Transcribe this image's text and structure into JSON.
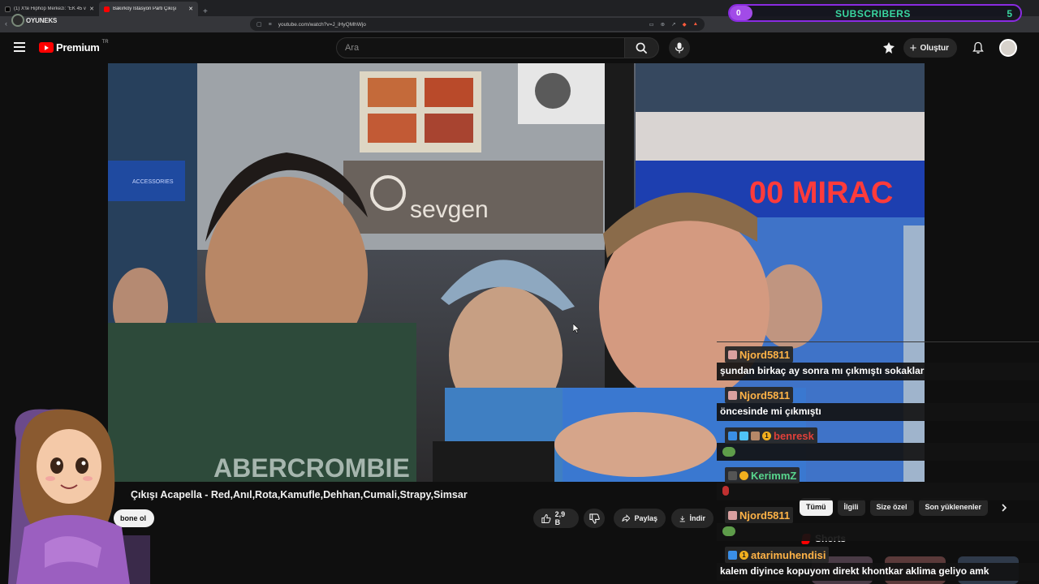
{
  "browser": {
    "tabs": [
      {
        "label": "(1) X'te Hiphop Merkezi: \"EK 45 ve II",
        "active": false
      },
      {
        "label": "Bakırköy İstasyon Parti Çıkışı",
        "active": true
      }
    ],
    "url": "youtube.com/watch?v=J_iHyQMhWjo"
  },
  "overlay": {
    "logo_text": "OYUNEKS",
    "subscribers": {
      "label": "SUBSCRIBERS",
      "current": "0",
      "goal": "5",
      "progress": 0.0
    }
  },
  "youtube": {
    "brand": "Premium",
    "region": "TR",
    "search_placeholder": "Ara",
    "create_label": "Oluştur",
    "video_title": "Çıkışı Acapella - Red,Anıl,Rota,Kamufle,Dehhan,Cumali,Strapy,Simsar",
    "subscribe_label": "bone ol",
    "like_count": "2,9 B",
    "share_label": "Paylaş",
    "download_label": "İndir",
    "chips": [
      {
        "label": "Tümü",
        "selected": true
      },
      {
        "label": "İlgili",
        "selected": false
      },
      {
        "label": "Size özel",
        "selected": false
      },
      {
        "label": "Son yüklenenler",
        "selected": false
      }
    ],
    "shorts_label": "Shorts"
  },
  "video_scene": {
    "shop_sign": "sevgen",
    "led_sign": "00 MIRAC",
    "store_small_sign": "ACCESSORIES",
    "shirt_text": "ABERCROMBIE"
  },
  "chat": [
    {
      "user": "Njord5811",
      "color": "#ffb347",
      "text": "şundan birkaç ay sonra mı çıkmıştı sokaklar"
    },
    {
      "user": "Njord5811",
      "color": "#ffb347",
      "text": "öncesinde mi çıkmıştı"
    },
    {
      "user": "benresk",
      "color": "#e0403a",
      "text": "",
      "badge_count": "1"
    },
    {
      "user": "KerimmZ",
      "color": "#58d68d",
      "text": ""
    },
    {
      "user": "Njord5811",
      "color": "#ffb347",
      "text": ""
    },
    {
      "user": "atarimuhendisi",
      "color": "#ffb347",
      "text": "kalem diyince kopuyom direkt khontkar aklima geliyo amk",
      "badge_count": "1"
    }
  ],
  "colors": {
    "bg": "#0f0f0f",
    "youtube_red": "#ff0000",
    "sub_purple": "#a24be8",
    "sub_green": "#39d7a0"
  }
}
